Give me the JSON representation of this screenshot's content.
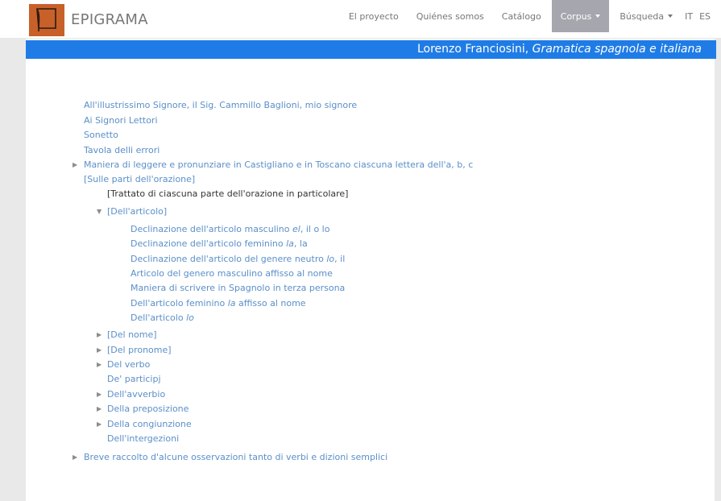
{
  "navbar": {
    "brand": "EPIGRAMA",
    "items": [
      {
        "label": "El proyecto"
      },
      {
        "label": "Quiénes somos"
      },
      {
        "label": "Catálogo"
      },
      {
        "label": "Corpus"
      },
      {
        "label": "Búsqueda"
      }
    ],
    "languages": [
      "IT",
      "ES"
    ]
  },
  "header": {
    "author": "Lorenzo Franciosini, ",
    "work": "Gramatica spagnola e italiana"
  },
  "colors": {
    "accent_blue": "#1f7ce6",
    "link_blue": "#5b8fc9",
    "active_nav": "#a6a6ae",
    "logo_orange": "#c8602a"
  },
  "tree": {
    "r1": "All'illustrissimo Signore, il Sig. Cammillo Baglioni, mio signore",
    "r2": "Ai Signori Lettori",
    "r3": "Sonetto",
    "r4": "Tavola delli errori",
    "r5": "Maniera di leggere e pronunziare in Castigliano e in Toscano ciascuna lettera dell'a, b, c",
    "r6": "[Sulle parti dell'orazione]",
    "r7": "[Trattato di ciascuna parte dell'orazione in particolare]",
    "r8": "[Dell'articolo]",
    "r9a": "Declinazione dell'articolo masculino ",
    "r9b": "el",
    "r9c": ", il o lo",
    "r10a": "Declinazione dell'articolo feminino ",
    "r10b": "la",
    "r10c": ", la",
    "r11a": "Declinazione dell'articolo del genere neutro ",
    "r11b": "lo",
    "r11c": ", il",
    "r12": "Articolo del genero masculino affisso al nome",
    "r13": "Maniera di scrivere in Spagnolo in terza persona",
    "r14a": "Dell'articolo feminino ",
    "r14b": "la",
    "r14c": " affisso al nome",
    "r15a": "Dell'articolo ",
    "r15b": "lo",
    "r16": "[Del nome]",
    "r17": "[Del pronome]",
    "r18": "Del verbo",
    "r19": "De' participj",
    "r20": "Dell'avverbio",
    "r21": "Della preposizione",
    "r22": "Della congiunzione",
    "r23": "Dell'intergezioni",
    "r24": "Breve raccolto d'alcune osservazioni tanto di verbi e dizioni semplici"
  }
}
